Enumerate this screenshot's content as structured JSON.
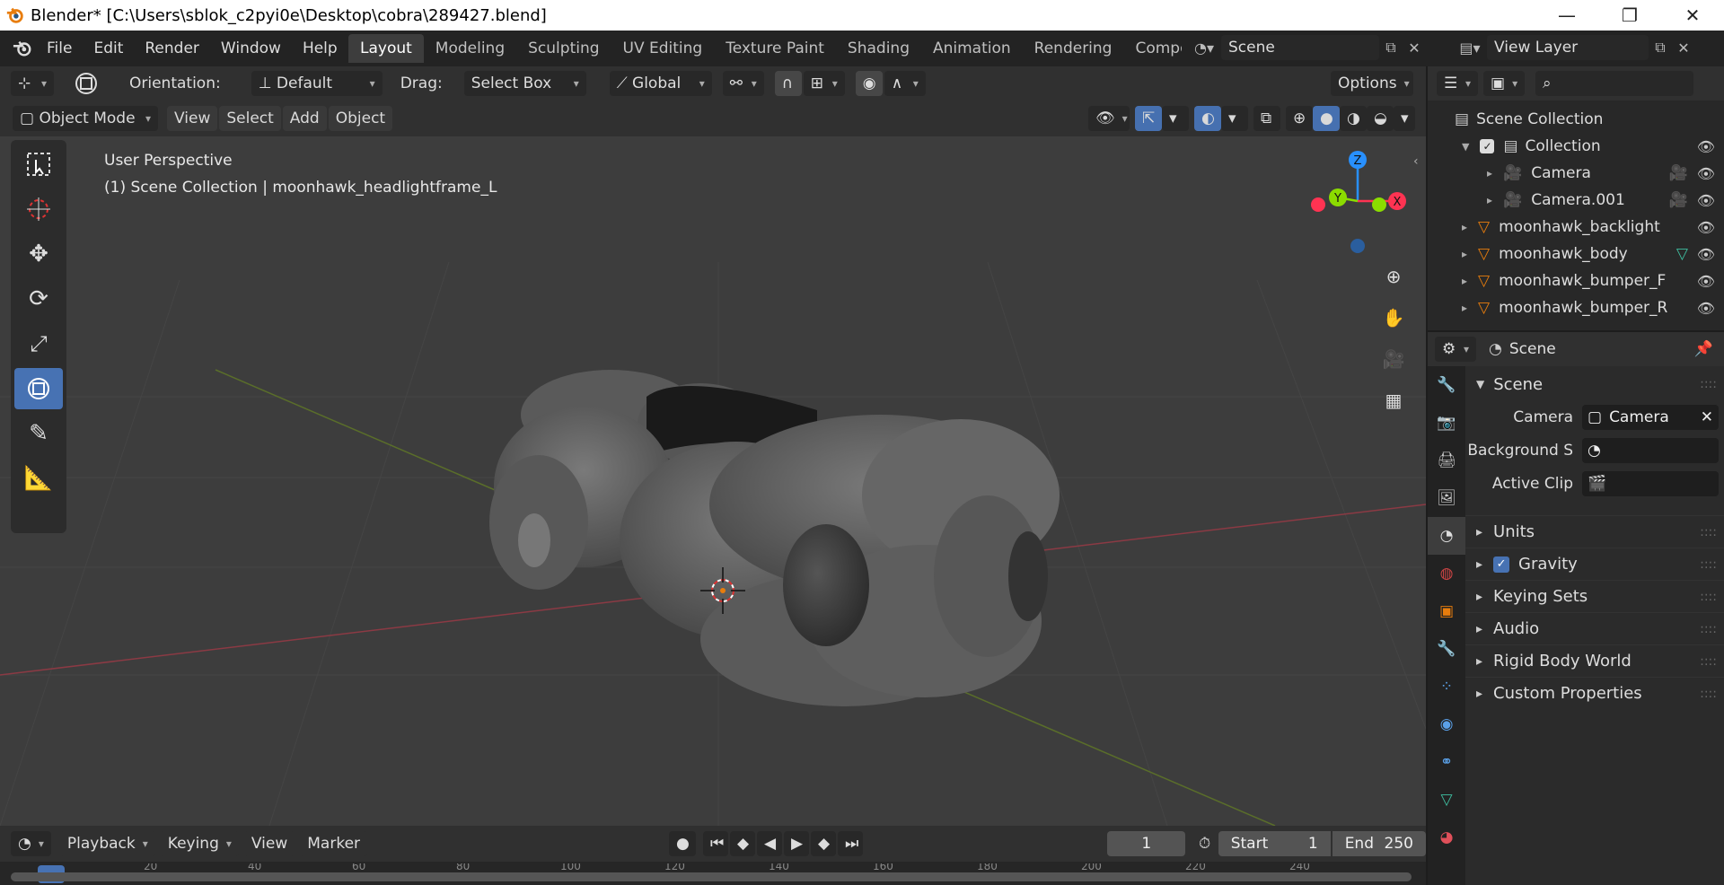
{
  "window": {
    "title": "Blender* [C:\\Users\\sblok_c2pyi0e\\Desktop\\cobra\\289427.blend]",
    "minimize": "—",
    "restore": "❐",
    "close": "✕"
  },
  "menu": [
    "File",
    "Edit",
    "Render",
    "Window",
    "Help"
  ],
  "workspaces": [
    "Layout",
    "Modeling",
    "Sculpting",
    "UV Editing",
    "Texture Paint",
    "Shading",
    "Animation",
    "Rendering",
    "Compos"
  ],
  "active_workspace": "Layout",
  "scene_selector": {
    "value": "Scene"
  },
  "view_layer_selector": {
    "value": "View Layer"
  },
  "tool_header": {
    "orientation_label": "Orientation:",
    "orientation_value": "Default",
    "drag_label": "Drag:",
    "drag_value": "Select Box",
    "transform_value": "Global",
    "options_label": "Options"
  },
  "viewport_header": {
    "mode": "Object Mode",
    "menus": [
      "View",
      "Select",
      "Add",
      "Object"
    ]
  },
  "viewport_info": {
    "line1": "User Perspective",
    "line2": "(1) Scene Collection | moonhawk_headlightframe_L"
  },
  "gizmo": {
    "x": "X",
    "y": "Y",
    "z": "Z"
  },
  "timeline": {
    "menus": [
      "Playback",
      "Keying",
      "View",
      "Marker"
    ],
    "current_frame": "1",
    "start_label": "Start",
    "start_value": "1",
    "end_label": "End",
    "end_value": "250",
    "ruler_ticks": [
      "20",
      "40",
      "60",
      "80",
      "100",
      "120",
      "140",
      "160",
      "180",
      "200",
      "220",
      "240"
    ]
  },
  "outliner": {
    "root": "Scene Collection",
    "collection": "Collection",
    "items": [
      {
        "name": "Camera",
        "type": "camera",
        "indent": 2
      },
      {
        "name": "Camera.001",
        "type": "camera",
        "indent": 2
      },
      {
        "name": "moonhawk_backlight",
        "type": "mesh",
        "indent": 1
      },
      {
        "name": "moonhawk_body",
        "type": "mesh",
        "indent": 1
      },
      {
        "name": "moonhawk_bumper_F",
        "type": "mesh",
        "indent": 1
      },
      {
        "name": "moonhawk_bumper_R",
        "type": "mesh",
        "indent": 1
      }
    ]
  },
  "properties": {
    "header": "Scene",
    "panel_title": "Scene",
    "camera_label": "Camera",
    "camera_value": "Camera",
    "background_label": "Background S",
    "active_clip_label": "Active Clip",
    "subpanels": [
      "Units",
      "Gravity",
      "Keying Sets",
      "Audio",
      "Rigid Body World",
      "Custom Properties"
    ]
  },
  "colors": {
    "accent": "#4772b3",
    "x_axis": "#ff3352",
    "y_axis": "#8bdc00",
    "z_axis": "#2890ff",
    "orange": "#e87d0d",
    "teal": "#3fbfa1"
  }
}
